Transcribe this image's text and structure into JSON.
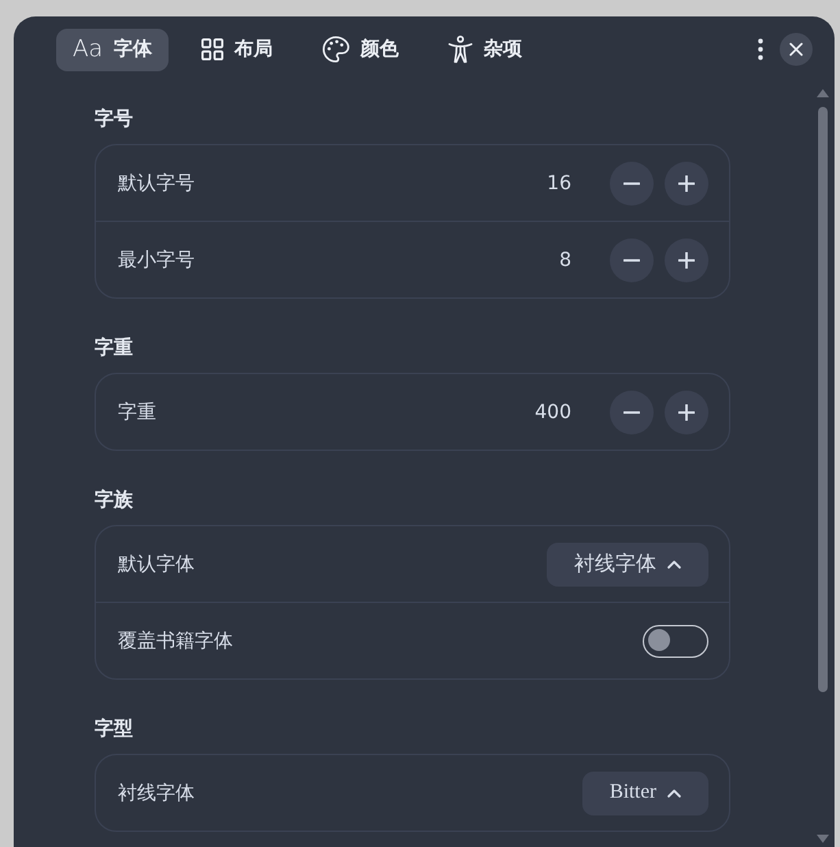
{
  "tabs": [
    {
      "label": "字体",
      "glyph": "Aa",
      "selected": true
    },
    {
      "label": "布局",
      "selected": false
    },
    {
      "label": "颜色",
      "selected": false
    },
    {
      "label": "杂项",
      "selected": false
    }
  ],
  "sections": [
    {
      "title": "字号",
      "rows": [
        {
          "kind": "stepper",
          "label": "默认字号",
          "value": "16"
        },
        {
          "kind": "stepper",
          "label": "最小字号",
          "value": "8"
        }
      ]
    },
    {
      "title": "字重",
      "rows": [
        {
          "kind": "stepper",
          "label": "字重",
          "value": "400"
        }
      ]
    },
    {
      "title": "字族",
      "rows": [
        {
          "kind": "dropdown",
          "label": "默认字体",
          "value": "衬线字体"
        },
        {
          "kind": "toggle",
          "label": "覆盖书籍字体",
          "on": false
        }
      ]
    },
    {
      "title": "字型",
      "rows": [
        {
          "kind": "dropdown",
          "label": "衬线字体",
          "value": "Bitter"
        }
      ]
    }
  ]
}
